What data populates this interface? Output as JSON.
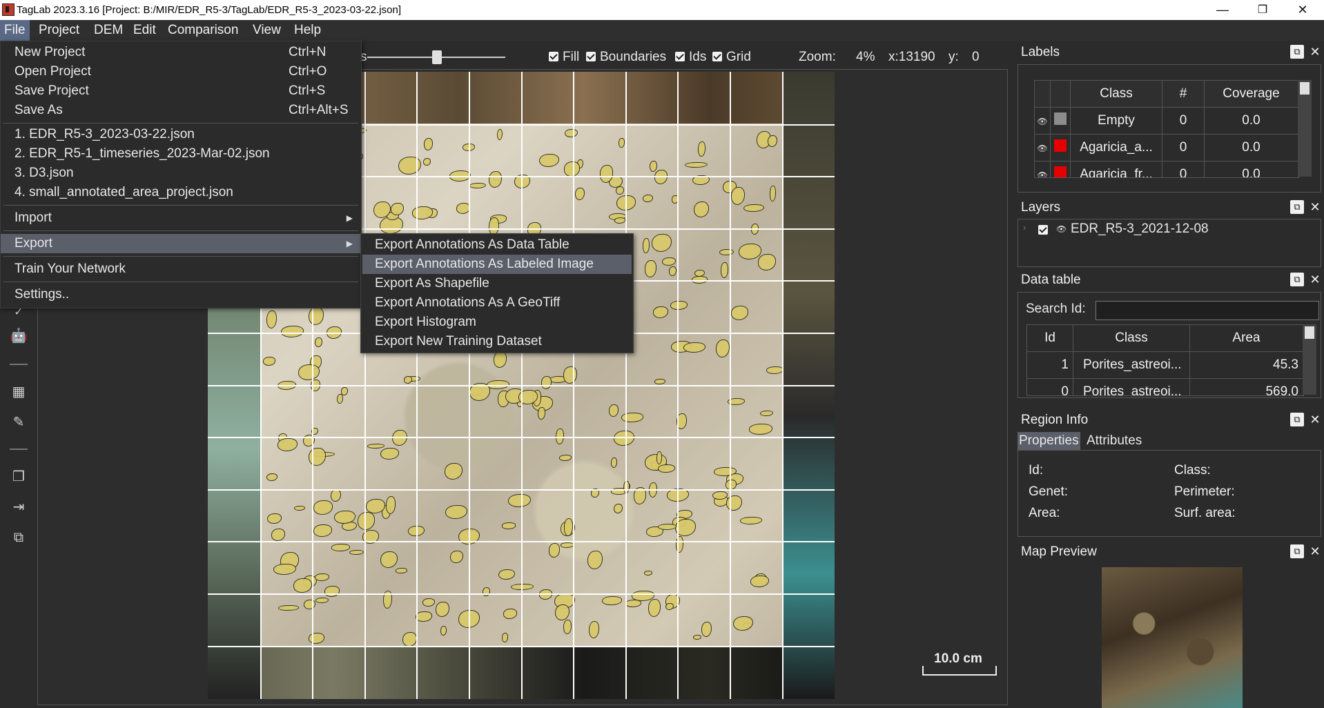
{
  "window": {
    "title": "TagLab 2023.3.16 [Project: B:/MIR/EDR_R5-3/TagLab/EDR_R5-3_2023-03-22.json]",
    "minimize": "—",
    "restore": "❐",
    "close": "✕"
  },
  "menubar": [
    "File",
    "Project",
    "DEM",
    "Edit",
    "Comparison",
    "View",
    "Help"
  ],
  "viewer_toolbar": {
    "slider_label_fragment": "s",
    "fill": "Fill",
    "boundaries": "Boundaries",
    "ids": "Ids",
    "grid": "Grid",
    "zoom_label": "Zoom:",
    "zoom_value": "4%",
    "x_label": "x:13190",
    "y_label": "y:",
    "y_value": "0"
  },
  "file_menu": {
    "new_project": {
      "label": "New Project",
      "shortcut": "Ctrl+N"
    },
    "open_project": {
      "label": "Open Project",
      "shortcut": "Ctrl+O"
    },
    "save_project": {
      "label": "Save Project",
      "shortcut": "Ctrl+S"
    },
    "save_as": {
      "label": "Save As",
      "shortcut": "Ctrl+Alt+S"
    },
    "recent": [
      "1. EDR_R5-3_2023-03-22.json",
      "2. EDR_R5-1_timeseries_2023-Mar-02.json",
      "3. D3.json",
      "4. small_annotated_area_project.json"
    ],
    "import": "Import",
    "export": "Export",
    "train": "Train Your Network",
    "settings": "Settings.."
  },
  "export_submenu": [
    "Export Annotations As Data Table",
    "Export Annotations As Labeled Image",
    "Export As Shapefile",
    "Export Annotations As A GeoTiff",
    "Export Histogram",
    "Export New Training Dataset"
  ],
  "scale_bar": "10.0 cm",
  "labels_panel": {
    "title": "Labels",
    "headers": [
      "Class",
      "#",
      "Coverage"
    ],
    "rows": [
      {
        "name": "Empty",
        "count": "0",
        "coverage": "0.0",
        "color": "#8c8c8c"
      },
      {
        "name": "Agaricia_a...",
        "count": "0",
        "coverage": "0.0",
        "color": "#e60000"
      },
      {
        "name": "Agaricia_fr...",
        "count": "0",
        "coverage": "0.0",
        "color": "#e60000"
      }
    ]
  },
  "layers_panel": {
    "title": "Layers",
    "layer_name": "EDR_R5-3_2021-12-08"
  },
  "data_table_panel": {
    "title": "Data table",
    "search_label": "Search Id:",
    "search_value": "",
    "headers": [
      "Id",
      "Class",
      "Area"
    ],
    "rows": [
      {
        "id": "1",
        "class": "Porites_astreoi...",
        "area": "45.3"
      },
      {
        "id": "0",
        "class": "Porites_astreoi...",
        "area": "569.0"
      }
    ]
  },
  "region_info_panel": {
    "title": "Region Info",
    "tabs": [
      "Properties",
      "Attributes"
    ],
    "fields": {
      "id": "Id:",
      "class": "Class:",
      "genet": "Genet:",
      "perimeter": "Perimeter:",
      "area": "Area:",
      "surf_area": "Surf. area:"
    }
  },
  "map_preview_panel": {
    "title": "Map Preview"
  }
}
